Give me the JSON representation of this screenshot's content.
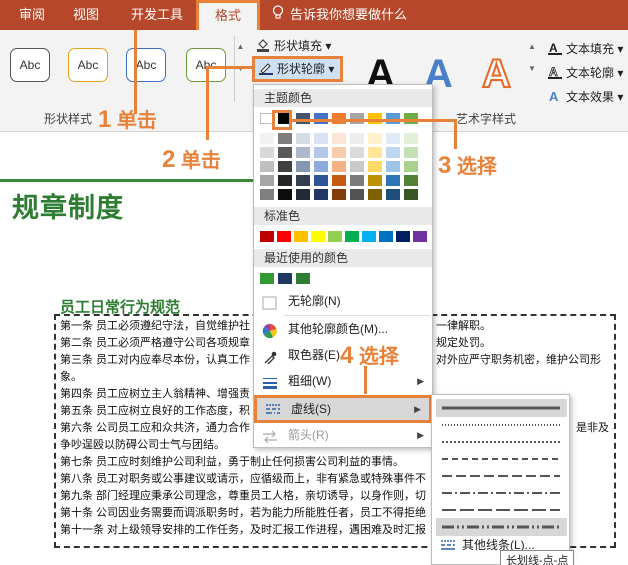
{
  "tabs": {
    "review": "审阅",
    "view": "视图",
    "developer": "开发工具",
    "format": "格式"
  },
  "tell_me": "告诉我你想要做什么",
  "ribbon": {
    "style_sample": "Abc",
    "shape_fill": "形状填充",
    "shape_outline": "形状轮廓",
    "shape_styles_label": "形状样式",
    "wordart_letter": "A",
    "wordart_label": "艺术字样式",
    "text_fill": "文本填充",
    "text_outline": "文本轮廓",
    "text_effect": "文本效果"
  },
  "menu": {
    "theme_colors": "主题颜色",
    "standard_colors": "标准色",
    "recent_colors": "最近使用的颜色",
    "no_outline": "无轮廓(N)",
    "more_colors": "其他轮廓颜色(M)...",
    "eyedropper": "取色器(E)",
    "weight": "粗细(W)",
    "dashes": "虚线(S)",
    "arrows": "箭头(R)"
  },
  "theme_colors": {
    "top_row": [
      "#ffffff",
      "#000000",
      "#44546a",
      "#4472c4",
      "#ed7d31",
      "#a5a5a5",
      "#ffc000",
      "#5b9bd5",
      "#70ad47"
    ],
    "tint_columns": [
      [
        "#f2f2f2",
        "#d9d9d9",
        "#bfbfbf",
        "#a6a6a6",
        "#808080"
      ],
      [
        "#7f7f7f",
        "#595959",
        "#404040",
        "#262626",
        "#0d0d0d"
      ],
      [
        "#d6dce4",
        "#adb9ca",
        "#8496b0",
        "#333f4f",
        "#222a35"
      ],
      [
        "#dae3f3",
        "#b4c7e7",
        "#8faadc",
        "#2f5597",
        "#1f3864"
      ],
      [
        "#fbe5d6",
        "#f8cbad",
        "#f4b183",
        "#c55a11",
        "#843c0c"
      ],
      [
        "#ededed",
        "#dbdbdb",
        "#c9c9c9",
        "#7b7b7b",
        "#525252"
      ],
      [
        "#fff2cc",
        "#ffe699",
        "#ffd966",
        "#bf9000",
        "#7f6000"
      ],
      [
        "#deebf7",
        "#bdd7ee",
        "#9dc3e6",
        "#2e75b6",
        "#1f4e79"
      ],
      [
        "#e2f0d9",
        "#c5e0b4",
        "#a9d18e",
        "#548235",
        "#385723"
      ]
    ]
  },
  "standard_colors": [
    "#c00000",
    "#ff0000",
    "#ffc000",
    "#ffff00",
    "#92d050",
    "#00b050",
    "#00b0f0",
    "#0070c0",
    "#002060",
    "#7030a0"
  ],
  "recent_colors": [
    "#339933",
    "#1f3864",
    "#2e7d32"
  ],
  "submenu": {
    "more_lines": "其他线条(L)...",
    "tooltip": "长划线-点-点"
  },
  "document": {
    "title": "规章制度",
    "section_title": "员工日常行为规范",
    "lines": [
      "第一条 员工必须遵纪守法，自觉维护社",
      "第二条 员工必须严格遵守公司各项规章",
      "第三条 员工对内应奉尽本份，认真工作",
      "象。",
      "第四条 员工应树立主人翁精神、增强责",
      "第五条 员工应树立良好的工作态度，积",
      "第六条 公司员工应和众共济，通力合作",
      "争吵逞殴以防碍公司士气与团结。",
      "第七条 员工应时刻维护公司利益，勇于制止任何损害公司利益的事情。",
      "第八条 员工对职务或公事建议或请示，应循级而上，非有紧急或特殊事件不",
      "第九条 部门经理应秉承公司理念，尊重员工人格，亲切诱导，以身作则，切",
      "第十条 公司因业务需要而调派职务时，若为能力所能胜任者，员工不得拒绝",
      "第十一条 对上级领导安排的工作任务，及时汇报工作进程，遇困难及时汇报"
    ],
    "right_fragments": [
      "一律解职。",
      "规定处罚。",
      "对外应严守职务机密，维护公司形",
      "",
      "",
      "",
      "是非及"
    ]
  },
  "annotations": {
    "step1_num": "1",
    "step1_text": "单击",
    "step2_num": "2",
    "step2_text": "单击",
    "step3_num": "3",
    "step3_text": "选择",
    "step4_num": "4",
    "step4_text": "选择"
  },
  "accent_color": "#e8823a",
  "brand_color": "#b7472a"
}
